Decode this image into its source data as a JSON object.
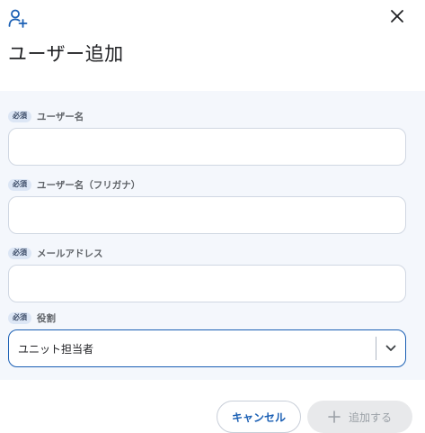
{
  "dialog": {
    "icon": "add-user-icon",
    "title": "ユーザー追加",
    "close_icon": "close-icon"
  },
  "form": {
    "required_badge": "必須",
    "fields": [
      {
        "label": "ユーザー名",
        "value": "",
        "placeholder": ""
      },
      {
        "label": "ユーザー名（フリガナ）",
        "value": "",
        "placeholder": ""
      },
      {
        "label": "メールアドレス",
        "value": "",
        "placeholder": ""
      }
    ],
    "role": {
      "label": "役割",
      "selected": "ユニット担当者",
      "icon": "chevron-down-icon"
    }
  },
  "footer": {
    "cancel_label": "キャンセル",
    "add_label": "追加する",
    "add_icon": "plus-icon",
    "add_enabled": false
  },
  "colors": {
    "accent": "#1a5fb4",
    "panel_bg": "#f4f7fc",
    "badge_bg": "#dce6f5",
    "disabled_bg": "#e8e9eb",
    "disabled_text": "#9aa0a6"
  }
}
